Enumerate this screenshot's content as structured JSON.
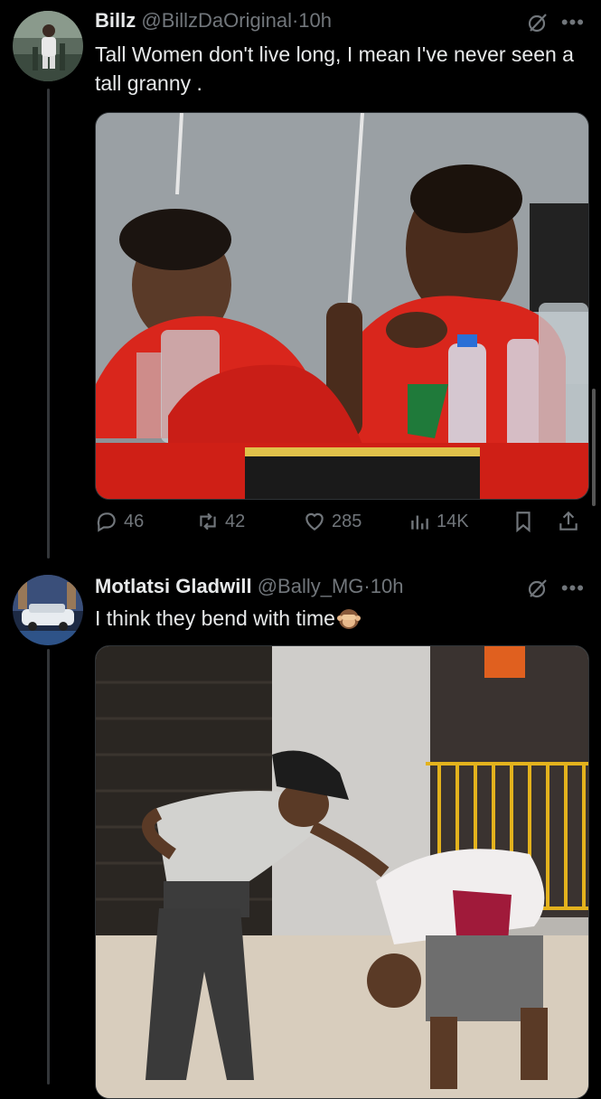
{
  "posts": [
    {
      "author": "Billz",
      "handle": "@BillzDaOriginal",
      "time": "10h",
      "text": "Tall Women don't live long, I mean I've never seen a tall granny .",
      "stats": {
        "replies": "46",
        "reposts": "42",
        "likes": "285",
        "views": "14K"
      }
    },
    {
      "author": "Motlatsi Gladwill",
      "handle": "@Bally_MG",
      "time": "10h",
      "text": "I think they bend with time"
    }
  ],
  "icons": [
    "reply-icon",
    "repost-icon",
    "like-icon",
    "views-icon",
    "bookmark-icon",
    "share-icon",
    "grok-icon",
    "more-icon",
    "see-no-evil-monkey-emoji"
  ],
  "colors": {
    "background": "#000000",
    "text": "#e7e9ea",
    "muted": "#71767b",
    "red_shirt": "#d9261c"
  }
}
